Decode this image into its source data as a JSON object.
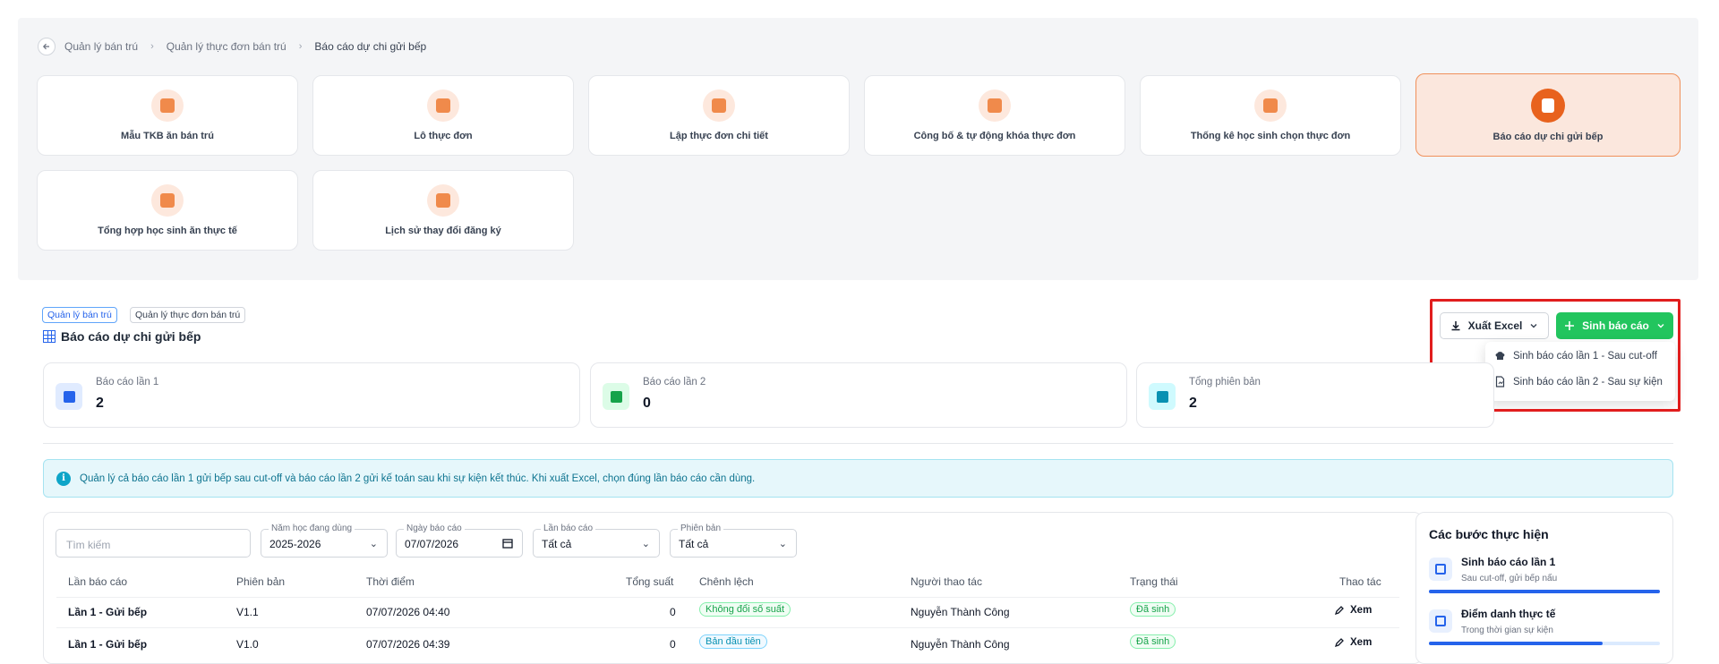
{
  "breadcrumb": {
    "items": [
      "Quản lý bán trú",
      "Quản lý thực đơn bán trú",
      "Báo cáo dự chi gửi bếp"
    ]
  },
  "modules": [
    {
      "label": "Mẫu TKB ăn bán trú",
      "icon": "calendar-icon"
    },
    {
      "label": "Lô thực đơn",
      "icon": "box-icon"
    },
    {
      "label": "Lập thực đơn chi tiết",
      "icon": "tag-icon"
    },
    {
      "label": "Công bố & tự động khóa thực đơn",
      "icon": "lock-icon"
    },
    {
      "label": "Thống kê học sinh chọn thực đơn",
      "icon": "chart-icon"
    },
    {
      "label": "Báo cáo dự chi gửi bếp",
      "icon": "report-icon",
      "active": true
    },
    {
      "label": "Tổng hợp học sinh ăn thực tế",
      "icon": "bag-icon"
    },
    {
      "label": "Lịch sử thay đổi đăng ký",
      "icon": "history-icon"
    }
  ],
  "tags": [
    "Quản lý bán trú",
    "Quản lý thực đơn bán trú"
  ],
  "page_title": "Báo cáo dự chi gửi bếp",
  "actions": {
    "export_label": "Xuất Excel",
    "generate_label": "Sinh báo cáo",
    "dropdown": [
      "Sinh báo cáo lần 1 - Sau cut-off",
      "Sinh báo cáo lần 2 - Sau sự kiện"
    ]
  },
  "stats": [
    {
      "label": "Báo cáo lần 1",
      "value": "2",
      "color": "#2563eb"
    },
    {
      "label": "Báo cáo lần 2",
      "value": "0",
      "color": "#16a34a"
    },
    {
      "label": "Tổng phiên bản",
      "value": "2",
      "color": "#0891b2"
    }
  ],
  "info_text": "Quản lý cả báo cáo lần 1 gửi bếp sau cut-off và báo cáo lần 2 gửi kế toán sau khi sự kiện kết thúc. Khi xuất Excel, chọn đúng lần báo cáo cần dùng.",
  "filters": {
    "search_placeholder": "Tìm kiếm",
    "year_label": "Năm học đang dùng",
    "year_value": "2025-2026",
    "date_label": "Ngày báo cáo",
    "date_value": "07/07/2026",
    "round_label": "Lần báo cáo",
    "round_value": "Tất cả",
    "version_label": "Phiên bản",
    "version_value": "Tất cả"
  },
  "table": {
    "columns": [
      "Lần báo cáo",
      "Phiên bản",
      "Thời điểm",
      "Tổng suất",
      "Chênh lệch",
      "Người thao tác",
      "Trạng thái",
      "Thao tác"
    ],
    "rows": [
      {
        "round": "Lần 1 - Gửi bếp",
        "version": "V1.1",
        "time": "07/07/2026 04:40",
        "total": "0",
        "diff": "Không đổi số suất",
        "user": "Nguyễn Thành Công",
        "status": "Đã sinh",
        "action": "Xem"
      },
      {
        "round": "Lần 1 - Gửi bếp",
        "version": "V1.0",
        "time": "07/07/2026 04:39",
        "total": "0",
        "diff": "Bản đầu tiên",
        "user": "Nguyễn Thành Công",
        "status": "Đã sinh",
        "action": "Xem"
      }
    ]
  },
  "steps": {
    "title": "Các bước thực hiện",
    "items": [
      {
        "title": "Sinh báo cáo lần 1",
        "sub": "Sau cut-off, gửi bếp nấu",
        "progress": 1.0
      },
      {
        "title": "Điểm danh thực tế",
        "sub": "Trong thời gian sự kiện",
        "progress": 0.75
      }
    ]
  },
  "colors": {
    "accent_orange": "#e8621d",
    "primary_green": "#22c55e",
    "highlight_red": "#e11d1d",
    "info_teal": "#0e7490"
  }
}
